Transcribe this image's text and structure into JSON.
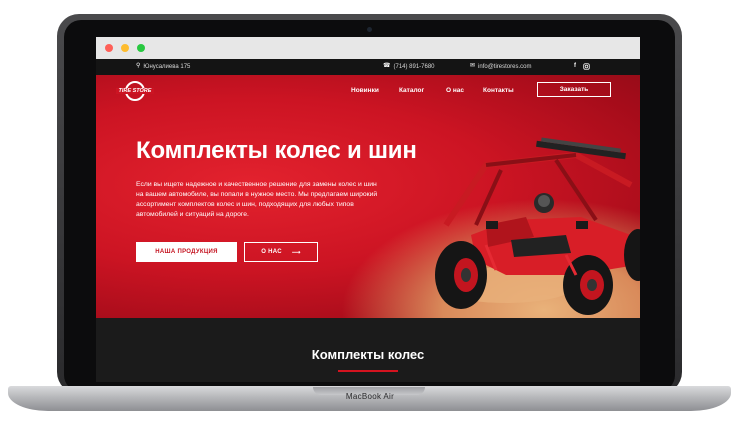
{
  "device": {
    "model_label": "MacBook Air"
  },
  "topbar": {
    "address": "Юнусалиева 175",
    "phone": "(714) 891-7680",
    "email": "info@tirestores.com",
    "social": [
      "facebook-icon",
      "instagram-icon"
    ]
  },
  "header": {
    "logo_text": "TIRE STORE",
    "nav": [
      "Новинки",
      "Каталог",
      "О нас",
      "Контакты"
    ],
    "order_button": "Заказать"
  },
  "hero": {
    "title": "Комплекты колес и шин",
    "text": "Если вы ищете надежное и качественное решение для замены колес и шин на вашем автомобиле, вы попали в нужное место. Мы предлагаем широкий ассортимент комплектов колес и шин, подходящих для любых типов автомобилей и ситуаций на дороге.",
    "primary_button": "НАША ПРОДУКЦИЯ",
    "secondary_button": "О НАС",
    "secondary_arrow": "⟶"
  },
  "section": {
    "title": "Комплекты колес"
  },
  "colors": {
    "brand_red": "#cc1423",
    "dark": "#1b1b1b"
  }
}
